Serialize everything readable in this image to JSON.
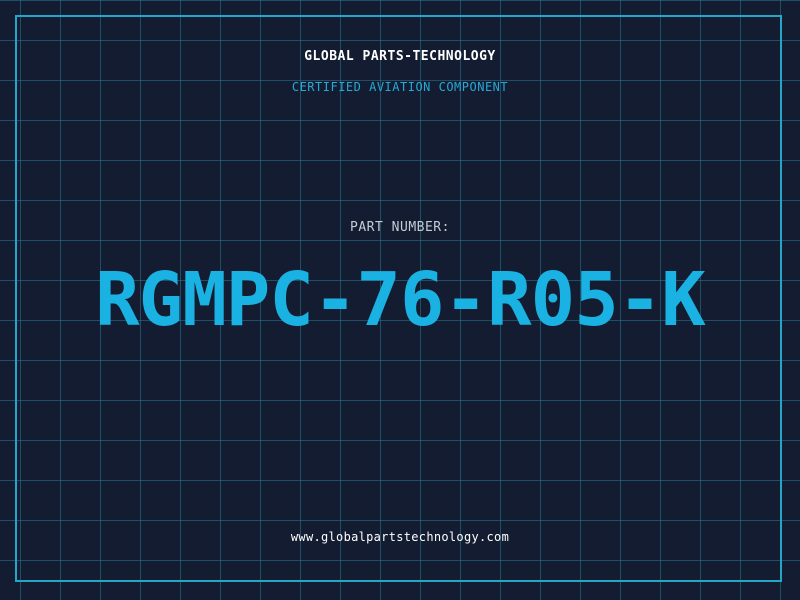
{
  "header": {
    "company": "GLOBAL PARTS-TECHNOLOGY",
    "tagline": "CERTIFIED AVIATION COMPONENT"
  },
  "part": {
    "label": "PART NUMBER:",
    "number": "RGMPC-76-R05-K"
  },
  "footer": {
    "website": "www.globalpartstechnology.com"
  },
  "colors": {
    "background": "#131c31",
    "grid": "#267896",
    "frame": "#23a6c8",
    "accent": "#1ab2e2",
    "text": "#ffffff"
  }
}
